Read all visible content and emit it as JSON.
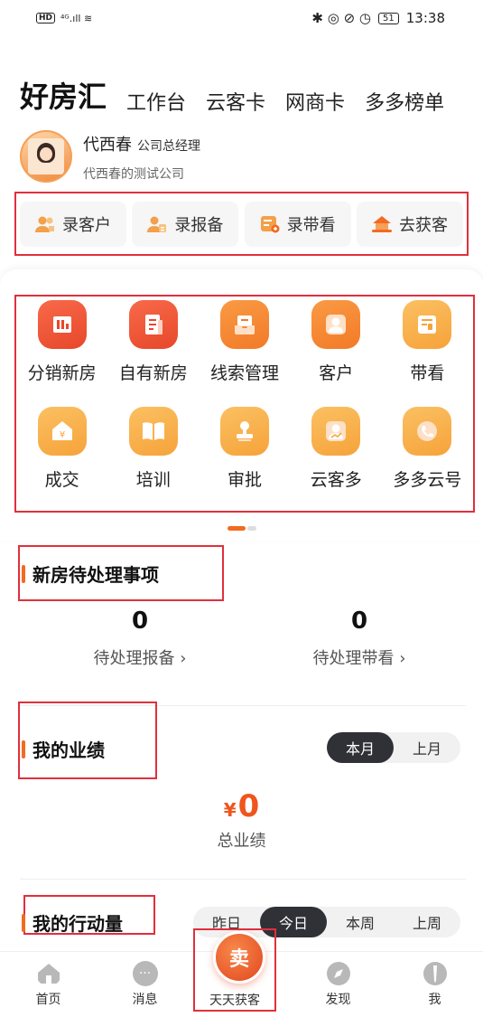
{
  "status_bar": {
    "left_hd": "HD",
    "left_signal": "⁴ᴳ.ıll ≋",
    "right_icons": "✱ ◎ ⊘ ◷",
    "battery": "51",
    "time": "13:38"
  },
  "tabs": [
    {
      "label": "好房汇",
      "active": true
    },
    {
      "label": "工作台",
      "active": false
    },
    {
      "label": "云客卡",
      "active": false
    },
    {
      "label": "网商卡",
      "active": false
    },
    {
      "label": "多多榜单",
      "active": false
    }
  ],
  "user": {
    "name": "代西春",
    "role": "公司总经理",
    "company": "代西春的测试公司"
  },
  "quick_actions": [
    {
      "label": "录客户",
      "icon": "add-customer-icon",
      "color": "#f3a04a"
    },
    {
      "label": "录报备",
      "icon": "add-report-icon",
      "color": "#f3a04a"
    },
    {
      "label": "录带看",
      "icon": "add-viewing-icon",
      "color": "#f3a04a"
    },
    {
      "label": "去获客",
      "icon": "acquire-icon",
      "color": "#f26b21"
    }
  ],
  "grid": [
    {
      "label": "分销新房",
      "icon": "building-icon",
      "tone": "red"
    },
    {
      "label": "自有新房",
      "icon": "document-icon",
      "tone": "red"
    },
    {
      "label": "线索管理",
      "icon": "inbox-icon",
      "tone": "org"
    },
    {
      "label": "客户",
      "icon": "person-icon",
      "tone": "org"
    },
    {
      "label": "带看",
      "icon": "card-icon",
      "tone": "yel"
    },
    {
      "label": "成交",
      "icon": "house-yen-icon",
      "tone": "yel"
    },
    {
      "label": "培训",
      "icon": "book-icon",
      "tone": "yel"
    },
    {
      "label": "审批",
      "icon": "stamp-icon",
      "tone": "yel"
    },
    {
      "label": "云客多",
      "icon": "person-chart-icon",
      "tone": "yel"
    },
    {
      "label": "多多云号",
      "icon": "phone-icon",
      "tone": "yel"
    }
  ],
  "pending": {
    "title": "新房待处理事项",
    "items": [
      {
        "count": "0",
        "label": "待处理报备 ›"
      },
      {
        "count": "0",
        "label": "待处理带看 ›"
      }
    ]
  },
  "performance": {
    "title": "我的业绩",
    "segments": [
      {
        "label": "本月",
        "on": true
      },
      {
        "label": "上月",
        "on": false
      }
    ],
    "currency": "¥",
    "value": "0",
    "label": "总业绩"
  },
  "actions_section": {
    "title": "我的行动量",
    "segments": [
      {
        "label": "昨日",
        "on": false
      },
      {
        "label": "今日",
        "on": true
      },
      {
        "label": "本周",
        "on": false
      },
      {
        "label": "上周",
        "on": false
      }
    ]
  },
  "bottom_nav": [
    {
      "label": "首页",
      "icon": "home-icon"
    },
    {
      "label": "消息",
      "icon": "message-icon"
    },
    {
      "label": "天天获客",
      "icon": "sell-icon",
      "center_glyph": "卖"
    },
    {
      "label": "发现",
      "icon": "compass-icon"
    },
    {
      "label": "我",
      "icon": "me-icon"
    }
  ]
}
